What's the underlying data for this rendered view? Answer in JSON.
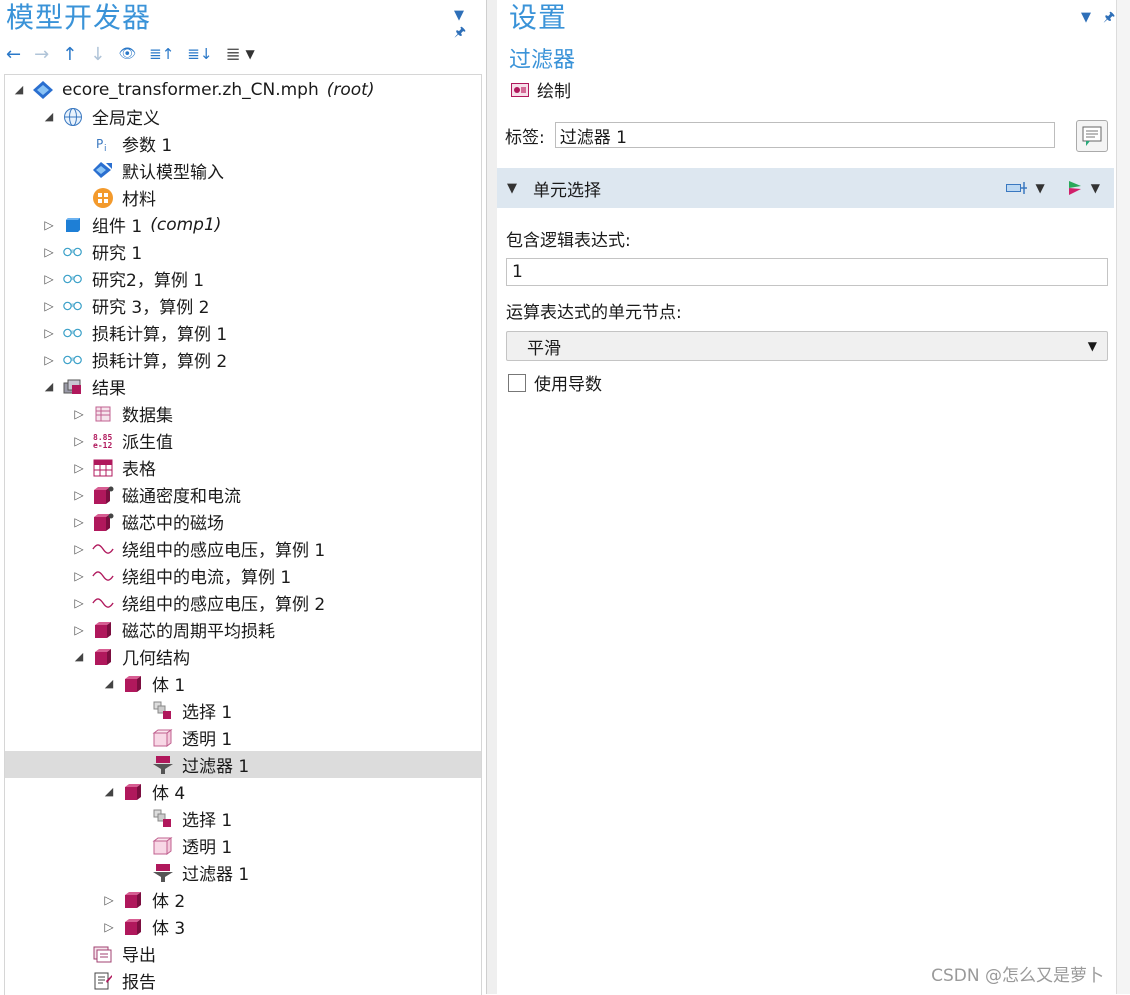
{
  "left_pane": {
    "title": "模型开发器",
    "ctrl_menu": "▼",
    "ctrl_pin": "🖈",
    "toolbar": {
      "back": "←",
      "forward": "→",
      "up": "↑",
      "down": "↓",
      "show": "👁",
      "collapse": "≣↑",
      "expand": "≣↓",
      "more": "≣",
      "dropdown": "▼"
    },
    "tree": [
      {
        "text": "ecore_transformer.zh_CN.mph",
        "tag": "(root)",
        "level": 0,
        "twisty": "open",
        "icon": "model-icon"
      },
      {
        "text": "全局定义",
        "level": 1,
        "twisty": "open",
        "icon": "globe-icon"
      },
      {
        "text": "参数 1",
        "level": 2,
        "twisty": "none",
        "icon": "parameter-icon"
      },
      {
        "text": "默认模型输入",
        "level": 2,
        "twisty": "none",
        "icon": "model-input-icon"
      },
      {
        "text": "材料",
        "level": 2,
        "twisty": "none",
        "icon": "materials-icon"
      },
      {
        "text": "组件 1",
        "tag": "(comp1)",
        "level": 1,
        "twisty": "closed",
        "icon": "component-icon"
      },
      {
        "text": "研究 1",
        "level": 1,
        "twisty": "closed",
        "icon": "study-icon"
      },
      {
        "text": "研究2，算例 1",
        "level": 1,
        "twisty": "closed",
        "icon": "study-icon"
      },
      {
        "text": "研究 3，算例 2",
        "level": 1,
        "twisty": "closed",
        "icon": "study-icon"
      },
      {
        "text": "损耗计算，算例 1",
        "level": 1,
        "twisty": "closed",
        "icon": "study-icon"
      },
      {
        "text": "损耗计算，算例 2",
        "level": 1,
        "twisty": "closed",
        "icon": "study-icon"
      },
      {
        "text": "结果",
        "level": 1,
        "twisty": "open",
        "icon": "results-icon"
      },
      {
        "text": "数据集",
        "level": 2,
        "twisty": "closed",
        "icon": "dataset-icon"
      },
      {
        "text": "派生值",
        "level": 2,
        "twisty": "closed",
        "icon": "derived-values-icon"
      },
      {
        "text": "表格",
        "level": 2,
        "twisty": "closed",
        "icon": "table-icon"
      },
      {
        "text": "磁通密度和电流",
        "level": 2,
        "twisty": "closed",
        "icon": "plot3d-icon"
      },
      {
        "text": "磁芯中的磁场",
        "level": 2,
        "twisty": "closed",
        "icon": "plot3d-icon"
      },
      {
        "text": "绕组中的感应电压，算例 1",
        "level": 2,
        "twisty": "closed",
        "icon": "wave-icon"
      },
      {
        "text": "绕组中的电流，算例 1",
        "level": 2,
        "twisty": "closed",
        "icon": "wave-icon"
      },
      {
        "text": "绕组中的感应电压，算例 2",
        "level": 2,
        "twisty": "closed",
        "icon": "wave-icon"
      },
      {
        "text": "磁芯的周期平均损耗",
        "level": 2,
        "twisty": "closed",
        "icon": "cube-icon"
      },
      {
        "text": "几何结构",
        "level": 2,
        "twisty": "open",
        "icon": "cube-icon"
      },
      {
        "text": "体 1",
        "level": 3,
        "twisty": "open",
        "icon": "cube-icon"
      },
      {
        "text": "选择 1",
        "level": 4,
        "twisty": "none",
        "icon": "selection-icon"
      },
      {
        "text": "透明 1",
        "level": 4,
        "twisty": "none",
        "icon": "transparency-icon"
      },
      {
        "text": "过滤器 1",
        "level": 4,
        "twisty": "none",
        "icon": "filter-icon",
        "selected": true
      },
      {
        "text": "体 4",
        "level": 3,
        "twisty": "open",
        "icon": "cube-icon"
      },
      {
        "text": "选择 1",
        "level": 4,
        "twisty": "none",
        "icon": "selection-icon"
      },
      {
        "text": "透明 1",
        "level": 4,
        "twisty": "none",
        "icon": "transparency-icon"
      },
      {
        "text": "过滤器 1",
        "level": 4,
        "twisty": "none",
        "icon": "filter-icon"
      },
      {
        "text": "体 2",
        "level": 3,
        "twisty": "closed",
        "icon": "cube-icon"
      },
      {
        "text": "体 3",
        "level": 3,
        "twisty": "closed",
        "icon": "cube-icon"
      },
      {
        "text": "导出",
        "level": 2,
        "twisty": "none",
        "icon": "export-icon"
      },
      {
        "text": "报告",
        "level": 2,
        "twisty": "none",
        "icon": "report-icon"
      }
    ]
  },
  "right_pane": {
    "title": "设置",
    "ctrl_menu": "▼",
    "ctrl_pin": "🖈",
    "subtitle": "过滤器",
    "plot_button": "绘制",
    "label_caption": "标签:",
    "label_value": "过滤器 1",
    "section": {
      "title": "单元选择",
      "collapse_glyph": "◢"
    },
    "logic_expr_label": "包含逻辑表达式:",
    "logic_expr_value": "1",
    "node_label": "运算表达式的单元节点:",
    "node_value": "平滑",
    "select_arrow": "▼",
    "checkbox_label": "使用导数"
  },
  "watermark": "CSDN @怎么又是萝卜",
  "colors": {
    "accent_blue": "#3a93d8",
    "magenta": "#b0185c",
    "selection_gray": "#dcdcdc",
    "section_bg": "#dde7f0"
  }
}
